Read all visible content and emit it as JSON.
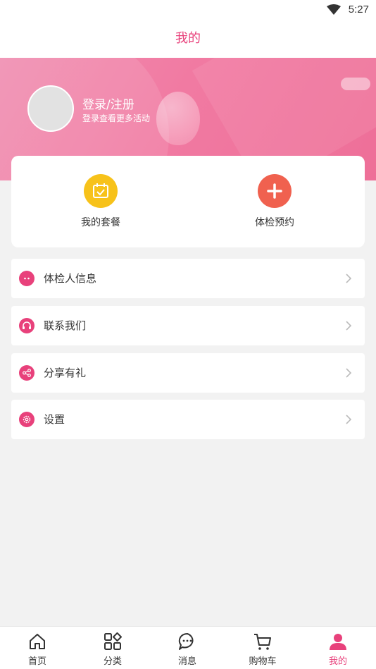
{
  "status_bar": {
    "time": "5:27",
    "wifi_icon": "wifi-icon"
  },
  "header": {
    "title": "我的"
  },
  "profile": {
    "login_label": "登录/注册",
    "subtitle": "登录查看更多活动"
  },
  "quick_actions": [
    {
      "label": "我的套餐",
      "icon": "calendar-check-icon",
      "color": "#f7c21a"
    },
    {
      "label": "体检预约",
      "icon": "plus-icon",
      "color": "#f0614f"
    }
  ],
  "menu": [
    {
      "label": "体检人信息",
      "icon": "chat-bubble-icon"
    },
    {
      "label": "联系我们",
      "icon": "headset-icon"
    },
    {
      "label": "分享有礼",
      "icon": "share-icon"
    },
    {
      "label": "设置",
      "icon": "gear-icon"
    }
  ],
  "tabs": [
    {
      "label": "首页",
      "icon": "home-icon",
      "active": false
    },
    {
      "label": "分类",
      "icon": "category-icon",
      "active": false
    },
    {
      "label": "消息",
      "icon": "message-icon",
      "active": false
    },
    {
      "label": "购物车",
      "icon": "cart-icon",
      "active": false
    },
    {
      "label": "我的",
      "icon": "user-icon",
      "active": true
    }
  ],
  "colors": {
    "accent": "#e8417b",
    "banner": "#f17aa2",
    "background": "#f2f2f2"
  }
}
